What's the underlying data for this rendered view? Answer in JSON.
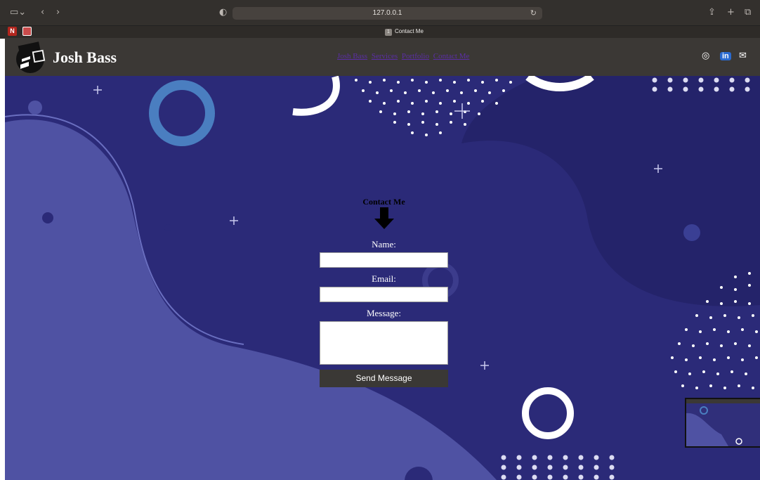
{
  "browser": {
    "url": "127.0.0.1",
    "tab_title": "Contact Me",
    "tab_number": "1"
  },
  "site": {
    "brand": "Josh Bass",
    "nav_links": [
      "Josh Bass",
      "Services",
      "Portfolio",
      "Contact Me"
    ]
  },
  "contact": {
    "heading": "Contact Me",
    "name_label": "Name:",
    "email_label": "Email:",
    "message_label": "Message:",
    "submit_label": "Send Message"
  },
  "colors": {
    "hero_bg": "#2b2a78",
    "hero_light": "#4f52a3",
    "nav_bg": "#3b3835",
    "link": "#5b2ea6"
  }
}
